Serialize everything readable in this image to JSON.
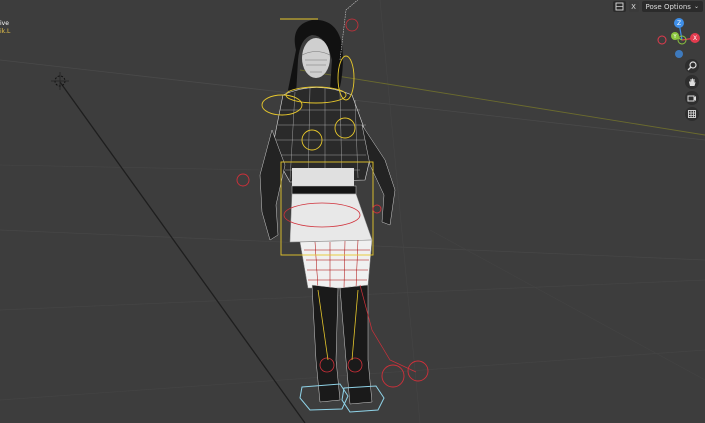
{
  "viewport": {
    "mode_text": "ive",
    "object_text": "ik.L"
  },
  "header": {
    "pose_options_label": "Pose Options",
    "close_label": "X",
    "chevron": "⌄"
  },
  "gizmo": {
    "axes": {
      "z": "Z",
      "y": "Y",
      "x": "X"
    },
    "colors": {
      "x": "#e23b4e",
      "y": "#8cc63f",
      "z": "#3f8fe8"
    }
  },
  "icons": {
    "gizmo_toggle": "gizmo-icon",
    "zoom": "magnifier-icon",
    "pan": "hand-icon",
    "camera": "camera-icon",
    "perspective": "grid-icon"
  },
  "colors": {
    "viewport_bg": "#3d3d3d",
    "bone_outline": "#e6c72c",
    "mesh": "#ffffff",
    "ik_controls": "#d0303a",
    "foot_controls": "#8fd3e8"
  }
}
